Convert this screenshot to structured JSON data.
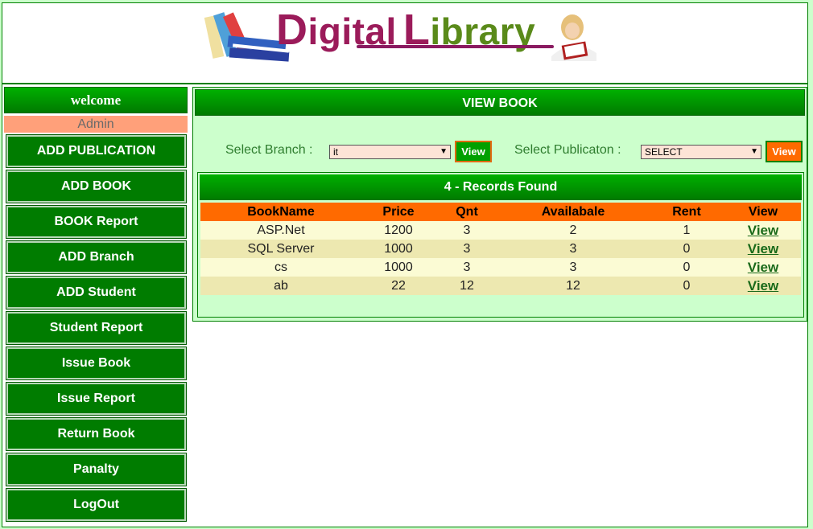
{
  "header": {
    "logo_part1": "Digital",
    "logo_initial2": "L",
    "logo_part2": "ibrary",
    "logo_initial1": "D"
  },
  "sidebar": {
    "welcome": "welcome",
    "user": "Admin",
    "items": [
      {
        "label": "ADD PUBLICATION"
      },
      {
        "label": "ADD BOOK"
      },
      {
        "label": "BOOK Report"
      },
      {
        "label": "ADD Branch"
      },
      {
        "label": "ADD Student"
      },
      {
        "label": "Student Report"
      },
      {
        "label": "Issue Book"
      },
      {
        "label": "Issue Report"
      },
      {
        "label": "Return Book"
      },
      {
        "label": "Panalty"
      },
      {
        "label": "LogOut"
      }
    ]
  },
  "main": {
    "title": "VIEW BOOK",
    "branch_label": "Select Branch :",
    "branch_value": "it",
    "branch_button": "View",
    "publication_label": "Select Publicaton :",
    "publication_value": "SELECT",
    "publication_button": "View",
    "records_title": "4 - Records Found",
    "columns": [
      "BookName",
      "Price",
      "Qnt",
      "Availabale",
      "Rent",
      "View"
    ],
    "rows": [
      {
        "name": "ASP.Net",
        "price": "1200",
        "qnt": "3",
        "available": "2",
        "rent": "1",
        "view": "View"
      },
      {
        "name": "SQL Server",
        "price": "1000",
        "qnt": "3",
        "available": "3",
        "rent": "0",
        "view": "View"
      },
      {
        "name": "cs",
        "price": "1000",
        "qnt": "3",
        "available": "3",
        "rent": "0",
        "view": "View"
      },
      {
        "name": "ab",
        "price": "22",
        "qnt": "12",
        "available": "12",
        "rent": "0",
        "view": "View"
      }
    ]
  },
  "colors": {
    "green_header": "#00a000",
    "orange_header": "#ff6a00",
    "page_bg": "#ccffcc",
    "admin_bg": "#ffa07a"
  }
}
